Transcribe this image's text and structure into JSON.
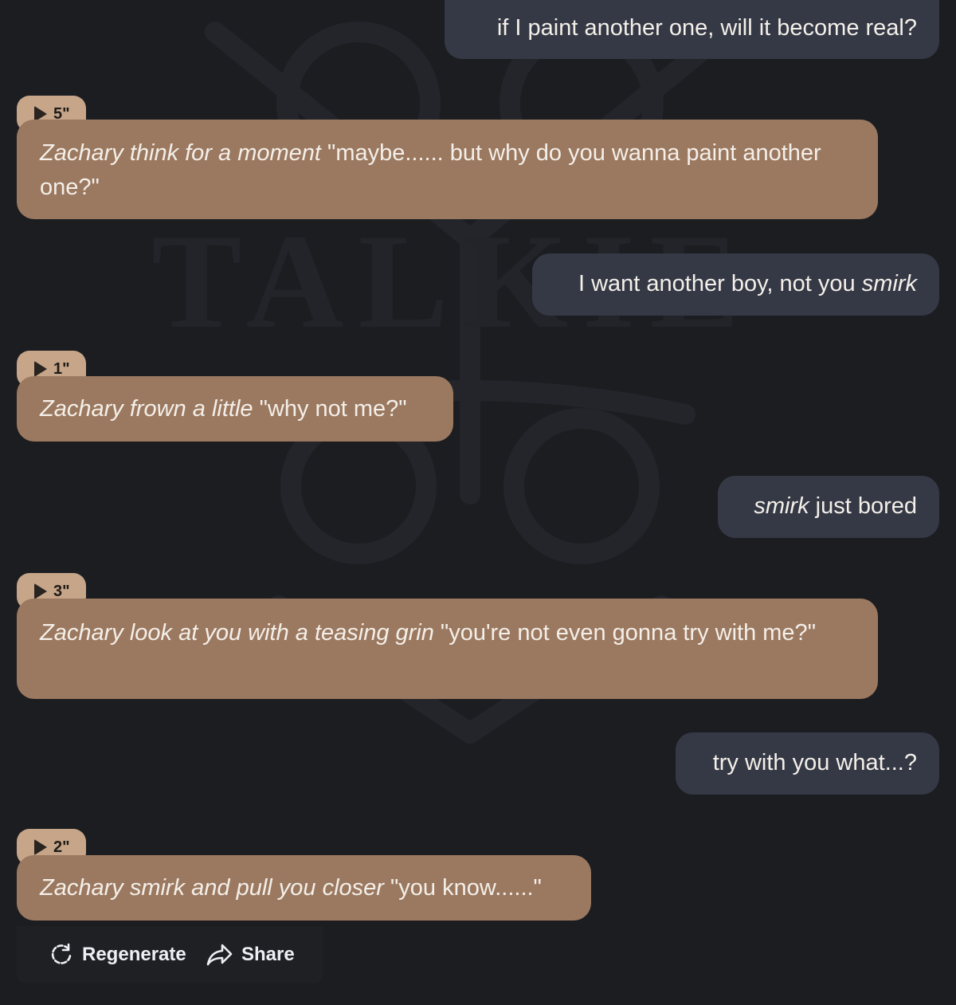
{
  "messages": [
    {
      "role": "user",
      "parts": [
        {
          "text": "if I paint another one, will it become real?",
          "italic": false
        }
      ]
    },
    {
      "role": "bot",
      "voice_duration": "5\"",
      "parts": [
        {
          "text": "Zachary think for a moment",
          "italic": true
        },
        {
          "text": " \"maybe...... but why do you wanna paint another one?\"",
          "italic": false
        }
      ]
    },
    {
      "role": "user",
      "parts": [
        {
          "text": "I want another boy, not you ",
          "italic": false
        },
        {
          "text": "smirk",
          "italic": true
        }
      ]
    },
    {
      "role": "bot",
      "voice_duration": "1\"",
      "parts": [
        {
          "text": "Zachary frown a little",
          "italic": true
        },
        {
          "text": " \"why not me?\"",
          "italic": false
        }
      ]
    },
    {
      "role": "user",
      "parts": [
        {
          "text": "smirk",
          "italic": true
        },
        {
          "text": " just bored",
          "italic": false
        }
      ]
    },
    {
      "role": "bot",
      "voice_duration": "3\"",
      "parts": [
        {
          "text": "Zachary look at you with a teasing grin",
          "italic": true
        },
        {
          "text": " \"you're not even gonna try with me?\"",
          "italic": false
        }
      ]
    },
    {
      "role": "user",
      "parts": [
        {
          "text": "try with you what...?",
          "italic": false
        }
      ]
    },
    {
      "role": "bot",
      "voice_duration": "2\"",
      "parts": [
        {
          "text": "Zachary smirk and pull you closer",
          "italic": true
        },
        {
          "text": " \"you know......\"",
          "italic": false
        }
      ]
    }
  ],
  "actions": {
    "regenerate_label": "Regenerate",
    "share_label": "Share"
  },
  "colors": {
    "background": "#1c1d21",
    "user_bubble": "#343945",
    "bot_bubble": "#9b7960",
    "voice_badge": "#c6a588",
    "text": "#f4efe9"
  },
  "icons": {
    "voice": "play-icon",
    "regenerate": "refresh-icon",
    "share": "share-arrow-icon"
  }
}
